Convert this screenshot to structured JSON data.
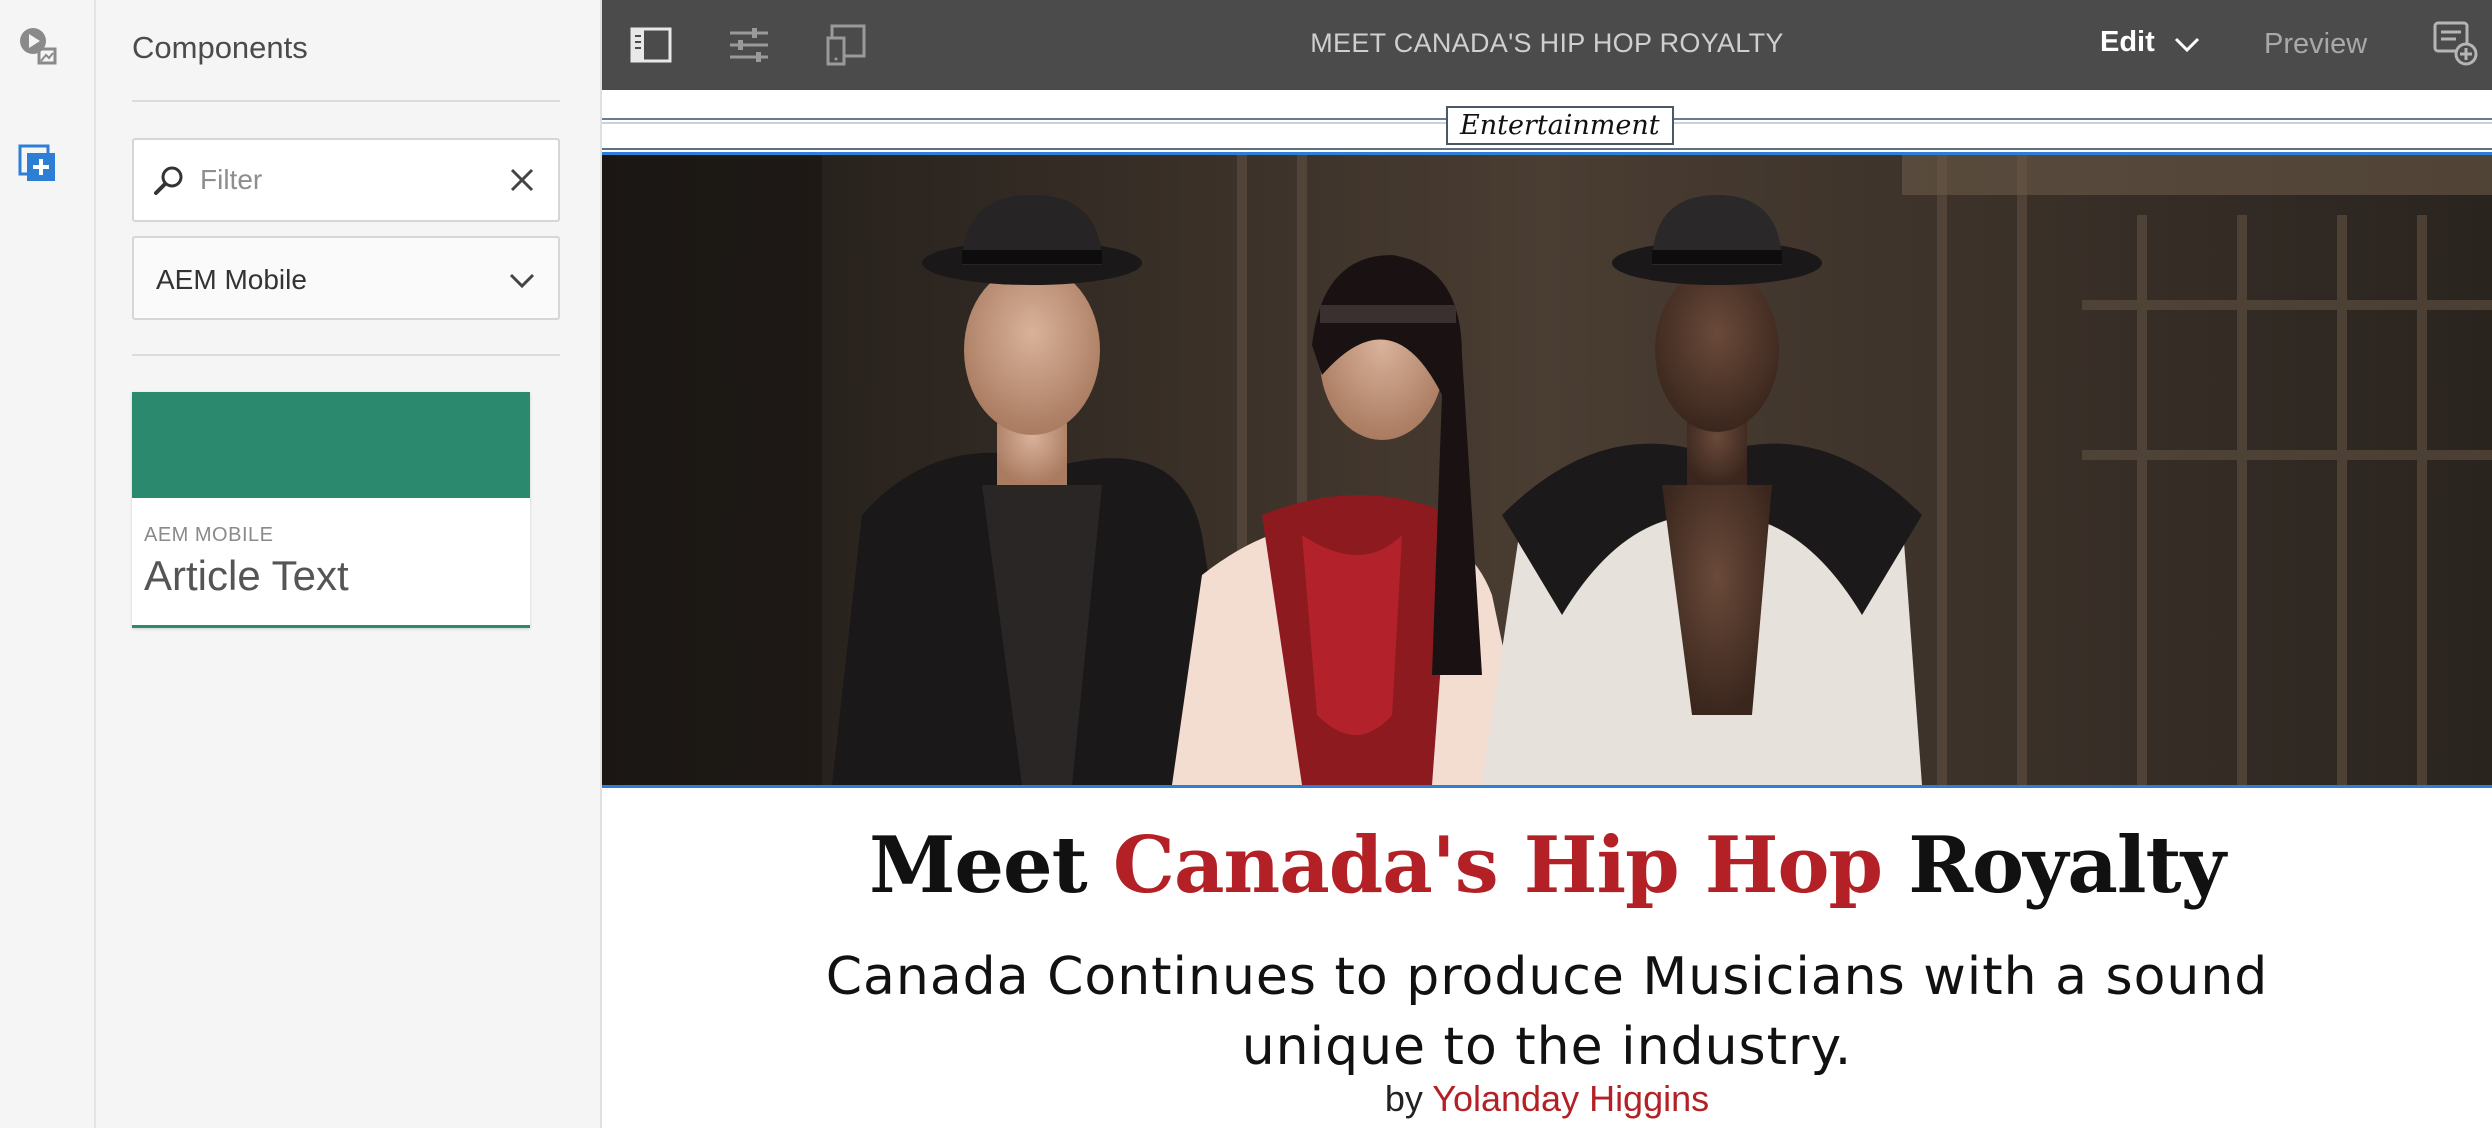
{
  "rail": {
    "icons": [
      "asset-play-icon",
      "add-component-icon"
    ]
  },
  "panel": {
    "title": "Components",
    "filter": {
      "placeholder": "Filter",
      "value": ""
    },
    "group_select": {
      "selected": "AEM Mobile"
    },
    "components": [
      {
        "category": "AEM MOBILE",
        "name": "Article Text",
        "color": "#2b8a6e"
      }
    ]
  },
  "toolbar": {
    "icons": [
      "side-panel-toggle-icon",
      "page-properties-icon",
      "emulator-icon",
      "annotations-icon"
    ],
    "page_title": "MEET CANADA'S HIP HOP ROYALTY",
    "mode_label": "Edit",
    "preview_label": "Preview"
  },
  "article": {
    "section_label": "Entertainment",
    "headline": {
      "part1": "Meet ",
      "part2": "Canada's Hip Hop",
      "part3": " Royalty"
    },
    "subhead": "Canada Continues to produce Musicians with a sound unique to the industry.",
    "byline_prefix": "by ",
    "author": "Yolanday Higgins",
    "accent_color": "#b32025",
    "selection_color": "#2d7fd6"
  }
}
